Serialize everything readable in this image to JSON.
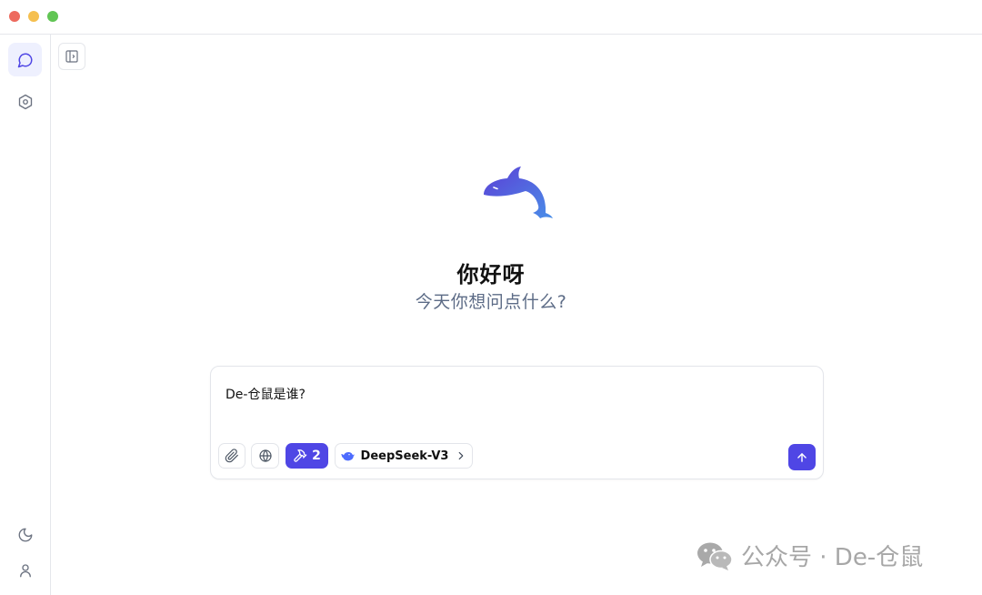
{
  "window": {
    "controls": [
      "close",
      "minimize",
      "maximize"
    ]
  },
  "sidebar": {
    "top_items": [
      {
        "icon": "chat-bubble-icon",
        "active": true
      },
      {
        "icon": "settings-hexagon-icon",
        "active": false
      }
    ],
    "bottom_items": [
      {
        "icon": "moon-icon"
      },
      {
        "icon": "user-icon"
      }
    ]
  },
  "header": {
    "panel_toggle_icon": "panel-toggle-icon"
  },
  "hero": {
    "logo_icon": "dolphin-logo-icon",
    "title": "你好呀",
    "subtitle": "今天你想问点什么?"
  },
  "composer": {
    "value": "De-仓鼠是谁?",
    "tools_count": "2",
    "model_name": "DeepSeek-V3",
    "send_icon": "arrow-up-icon"
  },
  "watermark": {
    "text": "公众号 · De-仓鼠"
  },
  "colors": {
    "accent": "#4f46e5",
    "subtitle": "#5c6b86",
    "border": "#e5e7eb"
  }
}
